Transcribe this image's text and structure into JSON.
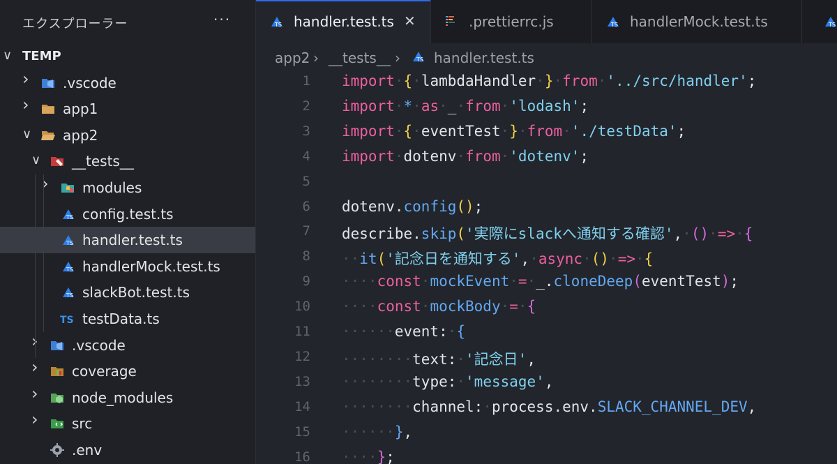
{
  "sidebar": {
    "title": "エクスプローラー",
    "more": "···",
    "tree": [
      {
        "label": "TEMP",
        "icon": "none",
        "twisty": "open",
        "depth": 0,
        "root": true
      },
      {
        "label": ".vscode",
        "icon": "vscode-folder-icon",
        "twisty": "closed",
        "depth": 1
      },
      {
        "label": "app1",
        "icon": "folder-icon",
        "twisty": "closed",
        "depth": 1
      },
      {
        "label": "app2",
        "icon": "folder-open-icon",
        "twisty": "open",
        "depth": 1
      },
      {
        "label": "__tests__",
        "icon": "tests-folder-icon",
        "twisty": "open",
        "depth": 2
      },
      {
        "label": "modules",
        "icon": "modules-folder-icon",
        "twisty": "closed",
        "depth": 3
      },
      {
        "label": "config.test.ts",
        "icon": "test-ts-icon",
        "twisty": "none",
        "depth": 3
      },
      {
        "label": "handler.test.ts",
        "icon": "test-ts-icon",
        "twisty": "none",
        "depth": 3,
        "selected": true
      },
      {
        "label": "handlerMock.test.ts",
        "icon": "test-ts-icon",
        "twisty": "none",
        "depth": 3
      },
      {
        "label": "slackBot.test.ts",
        "icon": "test-ts-icon",
        "twisty": "none",
        "depth": 3
      },
      {
        "label": "testData.ts",
        "icon": "ts-icon",
        "twisty": "none",
        "depth": 3
      },
      {
        "label": ".vscode",
        "icon": "vscode-folder-icon",
        "twisty": "closed",
        "depth": 2
      },
      {
        "label": "coverage",
        "icon": "coverage-folder-icon",
        "twisty": "closed",
        "depth": 2
      },
      {
        "label": "node_modules",
        "icon": "node-folder-icon",
        "twisty": "closed",
        "depth": 2
      },
      {
        "label": "src",
        "icon": "src-folder-icon",
        "twisty": "closed",
        "depth": 2
      },
      {
        "label": ".env",
        "icon": "gear-icon",
        "twisty": "none",
        "depth": 2
      }
    ]
  },
  "tabs": [
    {
      "label": "handler.test.ts",
      "icon": "test-ts-icon",
      "active": true,
      "close": "✕"
    },
    {
      "label": ".prettierrc.js",
      "icon": "prettier-icon",
      "active": false
    },
    {
      "label": "handlerMock.test.ts",
      "icon": "test-ts-icon",
      "active": false
    }
  ],
  "breadcrumb": {
    "parts": [
      "app2",
      "__tests__",
      "handler.test.ts"
    ],
    "sep": "›"
  },
  "editor": {
    "lines": [
      {
        "n": "1",
        "toks": [
          [
            "kw",
            "import"
          ],
          [
            "ws",
            "·"
          ],
          [
            "br",
            "{"
          ],
          [
            "ws",
            "·"
          ],
          [
            "id",
            "lambdaHandler"
          ],
          [
            "ws",
            "·"
          ],
          [
            "br",
            "}"
          ],
          [
            "ws",
            "·"
          ],
          [
            "kw",
            "from"
          ],
          [
            "ws",
            "·"
          ],
          [
            "str",
            "'../src/handler'"
          ],
          [
            "id",
            ";"
          ]
        ]
      },
      {
        "n": "2",
        "toks": [
          [
            "kw",
            "import"
          ],
          [
            "ws",
            "·"
          ],
          [
            "fn",
            "*"
          ],
          [
            "ws",
            "·"
          ],
          [
            "kw",
            "as"
          ],
          [
            "ws",
            "·"
          ],
          [
            "id",
            "_"
          ],
          [
            "ws",
            "·"
          ],
          [
            "kw",
            "from"
          ],
          [
            "ws",
            "·"
          ],
          [
            "str",
            "'lodash'"
          ],
          [
            "id",
            ";"
          ]
        ]
      },
      {
        "n": "3",
        "toks": [
          [
            "kw",
            "import"
          ],
          [
            "ws",
            "·"
          ],
          [
            "br",
            "{"
          ],
          [
            "ws",
            "·"
          ],
          [
            "id",
            "eventTest"
          ],
          [
            "ws",
            "·"
          ],
          [
            "br",
            "}"
          ],
          [
            "ws",
            "·"
          ],
          [
            "kw",
            "from"
          ],
          [
            "ws",
            "·"
          ],
          [
            "str",
            "'./testData'"
          ],
          [
            "id",
            ";"
          ]
        ]
      },
      {
        "n": "4",
        "toks": [
          [
            "kw",
            "import"
          ],
          [
            "ws",
            "·"
          ],
          [
            "id",
            "dotenv"
          ],
          [
            "ws",
            "·"
          ],
          [
            "kw",
            "from"
          ],
          [
            "ws",
            "·"
          ],
          [
            "str",
            "'dotenv'"
          ],
          [
            "id",
            ";"
          ]
        ]
      },
      {
        "n": "5",
        "toks": []
      },
      {
        "n": "6",
        "toks": [
          [
            "id",
            "dotenv."
          ],
          [
            "fn",
            "config"
          ],
          [
            "br",
            "()"
          ],
          [
            "id",
            ";"
          ]
        ]
      },
      {
        "n": "7",
        "toks": [
          [
            "id",
            "describe."
          ],
          [
            "fn",
            "skip"
          ],
          [
            "br",
            "("
          ],
          [
            "str",
            "'実際にslackへ通知する確認'"
          ],
          [
            "id",
            ","
          ],
          [
            "ws",
            "·"
          ],
          [
            "br2",
            "()"
          ],
          [
            "ws",
            "·"
          ],
          [
            "op",
            "=>"
          ],
          [
            "ws",
            "·"
          ],
          [
            "br2",
            "{"
          ]
        ]
      },
      {
        "n": "8",
        "toks": [
          [
            "ws",
            "··"
          ],
          [
            "fn",
            "it"
          ],
          [
            "br",
            "("
          ],
          [
            "str",
            "'記念日を通知する'"
          ],
          [
            "id",
            ","
          ],
          [
            "ws",
            "·"
          ],
          [
            "kw",
            "async"
          ],
          [
            "ws",
            "·"
          ],
          [
            "br",
            "()"
          ],
          [
            "ws",
            "·"
          ],
          [
            "op",
            "=>"
          ],
          [
            "ws",
            "·"
          ],
          [
            "br",
            "{"
          ]
        ]
      },
      {
        "n": "9",
        "toks": [
          [
            "ws",
            "····"
          ],
          [
            "kw",
            "const"
          ],
          [
            "ws",
            "·"
          ],
          [
            "const",
            "mockEvent"
          ],
          [
            "ws",
            "·"
          ],
          [
            "op",
            "="
          ],
          [
            "ws",
            "·"
          ],
          [
            "id",
            "_."
          ],
          [
            "fn",
            "cloneDeep"
          ],
          [
            "br2",
            "("
          ],
          [
            "id",
            "eventTest"
          ],
          [
            "br2",
            ")"
          ],
          [
            "id",
            ";"
          ]
        ]
      },
      {
        "n": "10",
        "toks": [
          [
            "ws",
            "····"
          ],
          [
            "kw",
            "const"
          ],
          [
            "ws",
            "·"
          ],
          [
            "const",
            "mockBody"
          ],
          [
            "ws",
            "·"
          ],
          [
            "op",
            "="
          ],
          [
            "ws",
            "·"
          ],
          [
            "br2",
            "{"
          ]
        ]
      },
      {
        "n": "11",
        "toks": [
          [
            "ws",
            "······"
          ],
          [
            "id",
            "event:"
          ],
          [
            "ws",
            "·"
          ],
          [
            "fn",
            "{"
          ]
        ]
      },
      {
        "n": "12",
        "toks": [
          [
            "ws",
            "········"
          ],
          [
            "id",
            "text:"
          ],
          [
            "ws",
            "·"
          ],
          [
            "str",
            "'記念日'"
          ],
          [
            "id",
            ","
          ]
        ]
      },
      {
        "n": "13",
        "toks": [
          [
            "ws",
            "········"
          ],
          [
            "id",
            "type:"
          ],
          [
            "ws",
            "·"
          ],
          [
            "str",
            "'message'"
          ],
          [
            "id",
            ","
          ]
        ]
      },
      {
        "n": "14",
        "toks": [
          [
            "ws",
            "········"
          ],
          [
            "id",
            "channel:"
          ],
          [
            "ws",
            "·"
          ],
          [
            "id",
            "process.env."
          ],
          [
            "const",
            "SLACK_CHANNEL_DEV"
          ],
          [
            "id",
            ","
          ]
        ]
      },
      {
        "n": "15",
        "toks": [
          [
            "ws",
            "······"
          ],
          [
            "fn",
            "}"
          ],
          [
            "id",
            ","
          ]
        ]
      },
      {
        "n": "16",
        "toks": [
          [
            "ws",
            "····"
          ],
          [
            "br2",
            "}"
          ],
          [
            "id",
            ";"
          ]
        ]
      }
    ]
  },
  "colors": {
    "accent": "#2e6bf2",
    "keyword": "#ec5fa0",
    "string": "#7fd0ef",
    "function": "#63a8f3",
    "bracket": "#f2d24e"
  }
}
